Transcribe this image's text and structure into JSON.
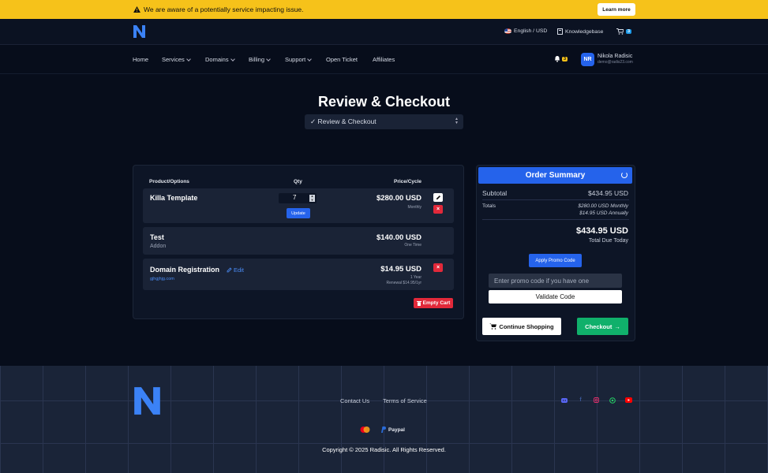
{
  "alert": {
    "text": "We are aware of a potentially service impacting issue.",
    "button": "Learn more"
  },
  "topbar": {
    "language": "English / USD",
    "knowledgebase": "Knowledgebase",
    "cart_count": "3"
  },
  "nav": {
    "items": [
      {
        "label": "Home"
      },
      {
        "label": "Services"
      },
      {
        "label": "Domains"
      },
      {
        "label": "Billing"
      },
      {
        "label": "Support"
      },
      {
        "label": "Open Ticket"
      },
      {
        "label": "Affiliates"
      }
    ],
    "notifications": "3",
    "user": {
      "initials": "NR",
      "name": "Nikola Radisic",
      "email": "demo@radis23.com"
    }
  },
  "page": {
    "title": "Review & Checkout",
    "step_select": "✓ Review & Checkout"
  },
  "cart": {
    "headers": {
      "product": "Product/Options",
      "qty": "Qty",
      "price": "Price/Cycle"
    },
    "items": [
      {
        "name": "Killa Template",
        "qty": "7",
        "update": "Update",
        "price": "$280.00 USD",
        "cycle": "Monthly"
      },
      {
        "name": "Test",
        "sub": "Addon",
        "price": "$140.00 USD",
        "cycle": "One Time"
      },
      {
        "name": "Domain Registration",
        "edit": "Edit",
        "domain": "gjhgjhjg.com",
        "price": "$14.95 USD",
        "cycle": "1 Year",
        "renewal": "Renewal $14.95/1yr"
      }
    ],
    "empty_cart": "Empty Cart"
  },
  "summary": {
    "title": "Order Summary",
    "subtotal_label": "Subtotal",
    "subtotal": "$434.95 USD",
    "totals_label": "Totals",
    "totals_monthly": "$280.00 USD Monthly",
    "totals_annually": "$14.95 USD Annually",
    "total_due": "$434.95 USD",
    "total_due_label": "Total Due Today",
    "promo_button": "Apply Promo Code",
    "promo_placeholder": "Enter promo code if you have one",
    "validate": "Validate Code",
    "continue": "Continue Shopping",
    "checkout": "Checkout"
  },
  "footer": {
    "links": [
      "Contact Us",
      "Terms of Service"
    ],
    "payments": [
      "Paypal"
    ],
    "copyright": "Copyright © 2025 Radisic. All Rights Reserved."
  },
  "colors": {
    "accent": "#2563eb",
    "alert": "#f6c21a",
    "danger": "#e2293a",
    "success": "#10b06b"
  }
}
